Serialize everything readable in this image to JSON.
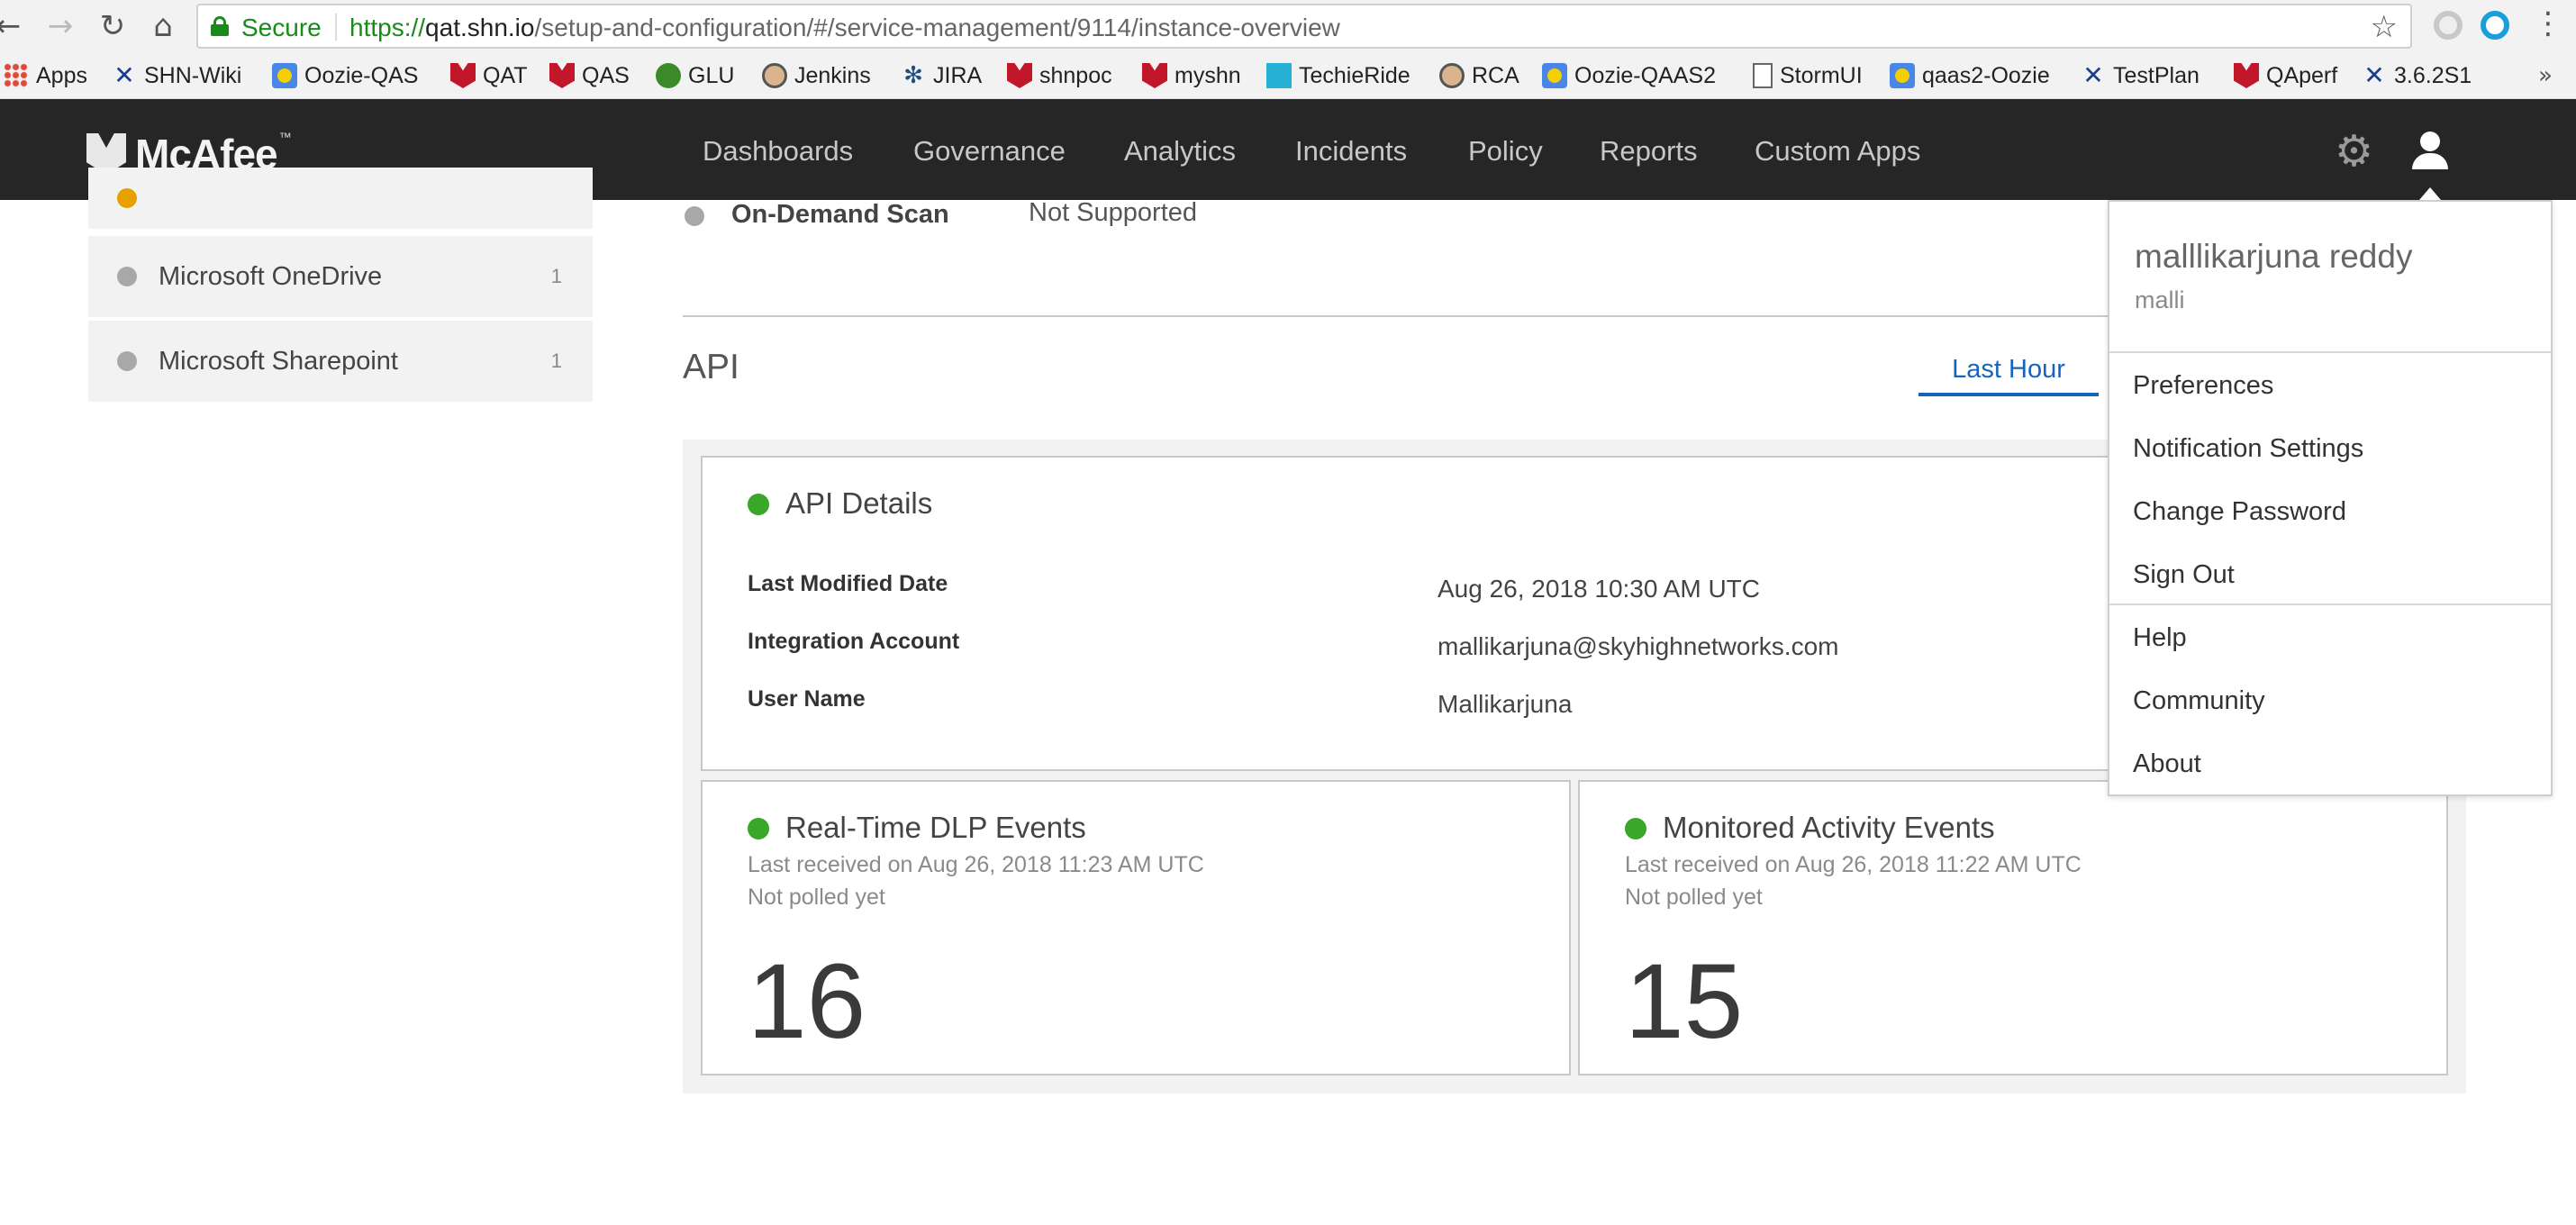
{
  "browser": {
    "secure_label": "Secure",
    "url_scheme": "https://",
    "url_host": "qat.shn.io",
    "url_path": "/setup-and-configuration/#/service-management/9114/instance-overview",
    "bookmarks": [
      {
        "label": "Apps",
        "icon": "apps-grid-icon"
      },
      {
        "label": "SHN-Wiki",
        "icon": "x-tool-icon"
      },
      {
        "label": "Oozie-QAS",
        "icon": "oozie-icon"
      },
      {
        "label": "QAT",
        "icon": "mcafee-shield-icon"
      },
      {
        "label": "QAS",
        "icon": "mcafee-shield-icon"
      },
      {
        "label": "GLU",
        "icon": "glu-icon"
      },
      {
        "label": "Jenkins",
        "icon": "jenkins-icon"
      },
      {
        "label": "JIRA",
        "icon": "jira-icon"
      },
      {
        "label": "shnpoc",
        "icon": "mcafee-shield-icon"
      },
      {
        "label": "myshn",
        "icon": "mcafee-shield-icon"
      },
      {
        "label": "TechieRide",
        "icon": "techieride-icon"
      },
      {
        "label": "RCA",
        "icon": "jenkins-icon"
      },
      {
        "label": "Oozie-QAAS2",
        "icon": "oozie-icon"
      },
      {
        "label": "StormUI",
        "icon": "document-icon"
      },
      {
        "label": "qaas2-Oozie",
        "icon": "oozie-icon"
      },
      {
        "label": "TestPlan",
        "icon": "x-tool-icon"
      },
      {
        "label": "QAperf",
        "icon": "mcafee-shield-icon"
      },
      {
        "label": "3.6.2S1",
        "icon": "x-tool-icon"
      }
    ]
  },
  "header": {
    "logo_text": "McAfee",
    "logo_tm": "™",
    "nav": [
      "Dashboards",
      "Governance",
      "Analytics",
      "Incidents",
      "Policy",
      "Reports",
      "Custom Apps"
    ]
  },
  "sidebar": {
    "items": [
      {
        "label": "Microsoft OneDrive",
        "count": "1"
      },
      {
        "label": "Microsoft Sharepoint",
        "count": "1"
      }
    ]
  },
  "content": {
    "on_demand_scan_label": "On-Demand Scan",
    "on_demand_scan_value": "Not Supported",
    "api_title": "API",
    "time_tab": "Last Hour",
    "api_details": {
      "title": "API Details",
      "rows": [
        {
          "label": "Last Modified Date",
          "value": "Aug 26, 2018 10:30 AM UTC"
        },
        {
          "label": "Integration Account",
          "value": "mallikarjuna@skyhighnetworks.com"
        },
        {
          "label": "User Name",
          "value": "Mallikarjuna"
        }
      ]
    },
    "dlp_events": {
      "title": "Real-Time DLP Events",
      "last_received": "Last received on Aug 26, 2018 11:23 AM UTC",
      "poll_status": "Not polled yet",
      "count": "16"
    },
    "monitored_events": {
      "title": "Monitored Activity Events",
      "last_received": "Last received on Aug 26, 2018 11:22 AM UTC",
      "poll_status": "Not polled yet",
      "count": "15"
    }
  },
  "user_menu": {
    "full_name": "malllikarjuna reddy",
    "short_name": "malli",
    "items": [
      "Preferences",
      "Notification Settings",
      "Change Password",
      "Sign Out",
      "Help",
      "Community",
      "About"
    ]
  },
  "colors": {
    "header_bg": "#262626",
    "accent_blue": "#1565c0",
    "status_green": "#3aa62a",
    "inactive_gray": "#a8a8a8",
    "secure_green": "#1a8a1a"
  }
}
